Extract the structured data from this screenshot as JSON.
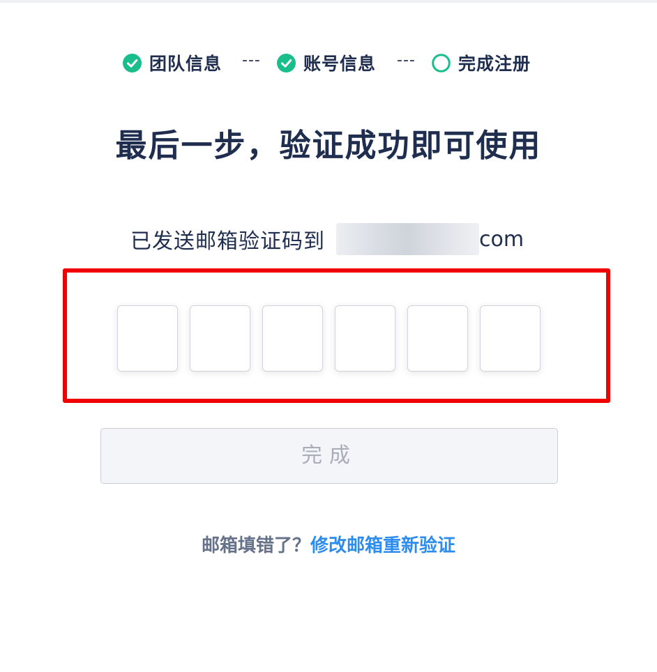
{
  "steps": [
    {
      "label": "团队信息",
      "status": "done",
      "icon": "check-circle-icon"
    },
    {
      "label": "账号信息",
      "status": "done",
      "icon": "check-circle-icon"
    },
    {
      "label": "完成注册",
      "status": "current",
      "icon": "circle-outline-icon"
    }
  ],
  "step_separator": "---",
  "heading": "最后一步，验证成功即可使用",
  "verification": {
    "sent_text": "已发送邮箱验证码到",
    "email_suffix": "com",
    "code_digits": [
      "",
      "",
      "",
      "",
      "",
      ""
    ]
  },
  "submit_label": "完成",
  "footer": {
    "question": "邮箱填错了？",
    "link": "修改邮箱重新验证"
  },
  "colors": {
    "accent_green": "#19be8c",
    "link_blue": "#2d8cf0",
    "heading_text": "#1f2d4e",
    "highlight_frame": "#f00000"
  }
}
